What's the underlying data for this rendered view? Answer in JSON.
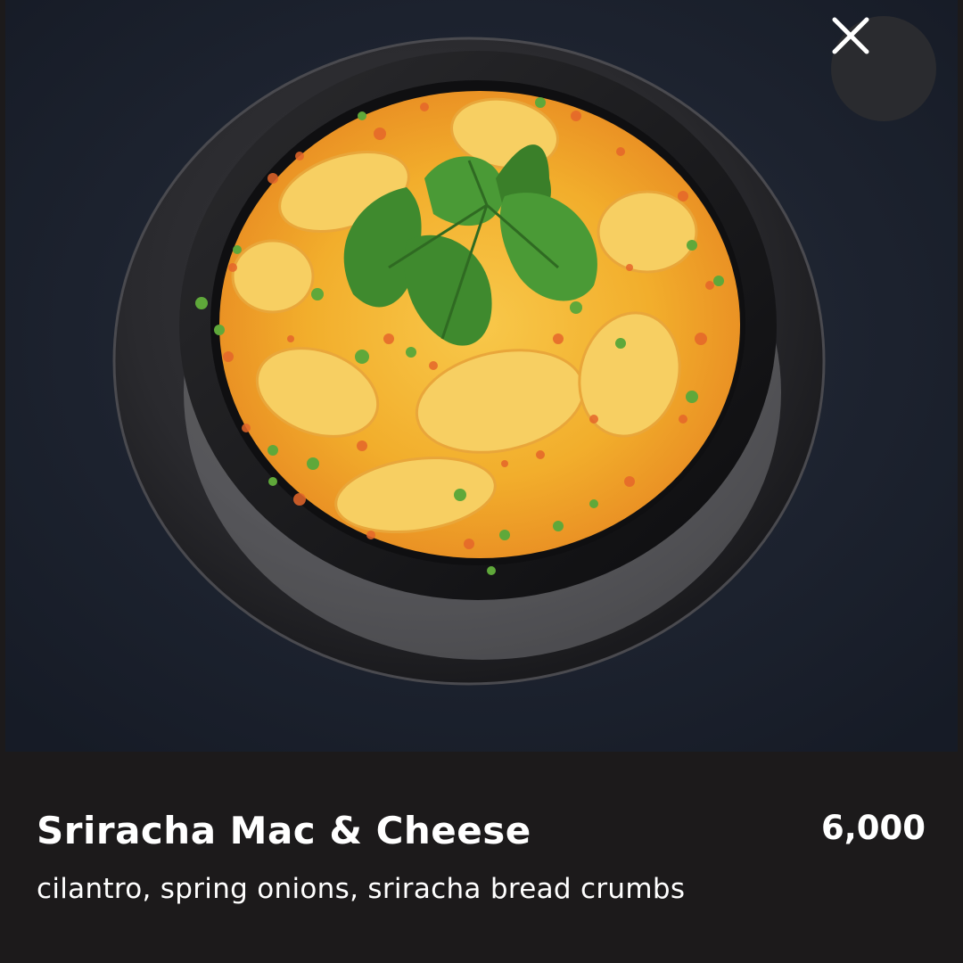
{
  "item": {
    "name": "Sriracha Mac & Cheese",
    "price": "6,000",
    "description": "cilantro, spring onions, sriracha bread crumbs"
  },
  "photo": {
    "subject": "Sriracha mac and cheese in a black bowl on a plate",
    "colors": {
      "background": "#1d2330",
      "plate": "#2c2c30",
      "bowl": "#101012",
      "cheese": "#f3b12a",
      "crumbs": "#e5662a",
      "herb": "#3f8a2e"
    }
  },
  "controls": {
    "close_icon": "close-icon"
  }
}
